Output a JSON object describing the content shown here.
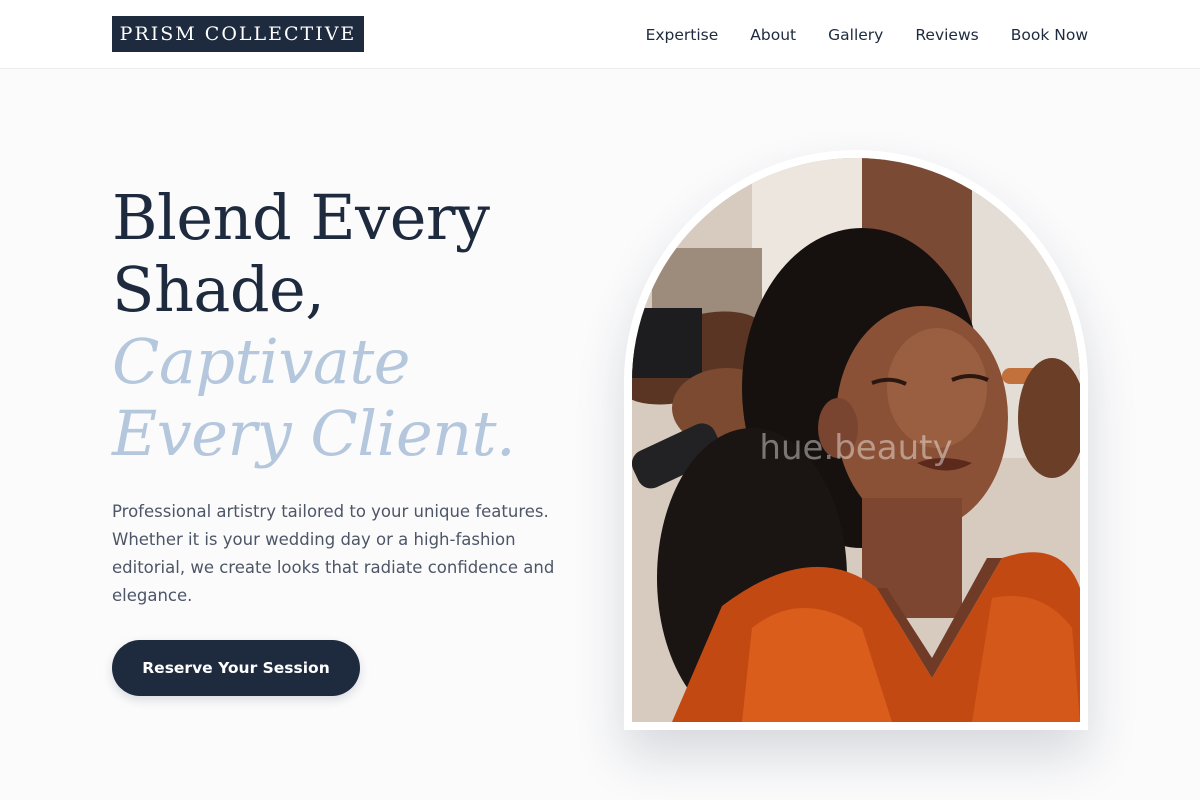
{
  "header": {
    "brand": "PRISM COLLECTIVE",
    "nav": [
      "Expertise",
      "About",
      "Gallery",
      "Reviews",
      "Book Now"
    ]
  },
  "hero": {
    "headline_line1": "Blend Every",
    "headline_line2": "Shade,",
    "headline_accent_line1": "Captivate",
    "headline_accent_line2": "Every Client.",
    "description": "Professional artistry tailored to your unique features. Whether it is your wedding day or a high-fashion editorial, we create looks that radiate confidence and elegance.",
    "cta_label": "Reserve Your Session",
    "image_watermark": "hue.beauty"
  },
  "colors": {
    "primary": "#1e2a3e",
    "accent": "#b4c7dd",
    "background": "#fbfbfc",
    "text_muted": "#4d5667"
  }
}
